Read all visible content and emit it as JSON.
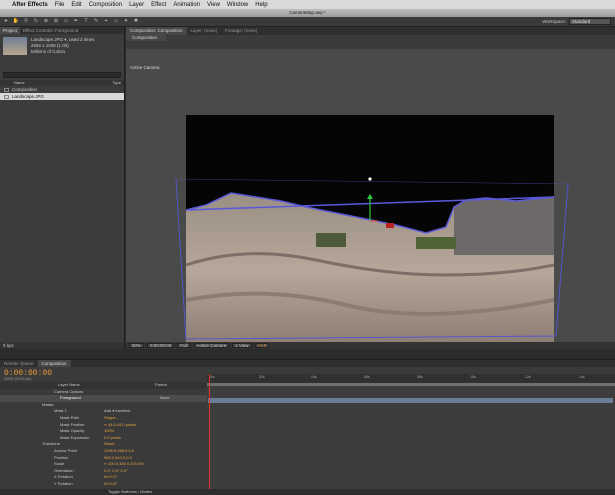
{
  "menubar": {
    "app_name": "After Effects",
    "items": [
      "File",
      "Edit",
      "Composition",
      "Layer",
      "Effect",
      "Animation",
      "View",
      "Window",
      "Help"
    ]
  },
  "window_title": "CameraMap.aep *",
  "toolbar": {
    "workspace_label": "Workspace:",
    "workspace_value": "Standard"
  },
  "project": {
    "tabs": [
      "Project",
      "Effect Controls: Foreground"
    ],
    "footage_name": "Landscape.JPG ▾, used 2 times",
    "footage_dims": "2592 x 1936 (1.00)",
    "footage_colors": "Millions of Colors",
    "col_name": "Name",
    "col_type": "Type",
    "items": [
      "Composition",
      "Landscape.JPG"
    ],
    "bpc": "8 bpc"
  },
  "comp_panel": {
    "tabs": [
      "Composition: Composition",
      "Layer: (none)",
      "Footage: (none)"
    ],
    "breadcrumb": "Composition",
    "view_label": "Active Camera",
    "zoom": "50%",
    "timecode": "0:00:00:00",
    "resolution": "Full",
    "camera": "Active Camera",
    "views": "1 View",
    "exposure": "+0.0"
  },
  "timeline": {
    "tabs": [
      "Render Queue",
      "Composition"
    ],
    "current_time": "0:00:00:00",
    "frames": "00000 (25.00 fps)",
    "ruler": [
      "00s",
      "02s",
      "04s",
      "06s",
      "08s",
      "10s",
      "12s",
      "14s"
    ],
    "layer_header": "Layer Name",
    "parent_header": "Parent",
    "rows": [
      {
        "label": "Camera Options",
        "value": ""
      },
      {
        "label": "Foreground",
        "value": "None"
      },
      {
        "label": "Masks",
        "value": ""
      },
      {
        "label": "Mask 1",
        "value": "Add ▾  Inverted"
      },
      {
        "label": "Mask Path",
        "value": "Shape..."
      },
      {
        "label": "Mask Feather",
        "value": "∞ 44.0,44.0 pixels"
      },
      {
        "label": "Mask Opacity",
        "value": "100%"
      },
      {
        "label": "Mask Expansion",
        "value": "0.0 pixels"
      },
      {
        "label": "Transform",
        "value": "Reset"
      },
      {
        "label": "Anchor Point",
        "value": "1296.0,968.0,0.0"
      },
      {
        "label": "Position",
        "value": "960.0,540.0,0.0"
      },
      {
        "label": "Scale",
        "value": "∞ 100.0,100.0,100.0%"
      },
      {
        "label": "Orientation",
        "value": "0.0°,0.0°,0.0°"
      },
      {
        "label": "X Rotation",
        "value": "0x+0.0°"
      },
      {
        "label": "Y Rotation",
        "value": "0x+0.0°"
      }
    ],
    "footer": "Toggle Switches / Modes"
  },
  "colors": {
    "accent_orange": "#e89a3c",
    "mask_blue": "#3a3ab8",
    "cti_red": "#e0342b"
  }
}
